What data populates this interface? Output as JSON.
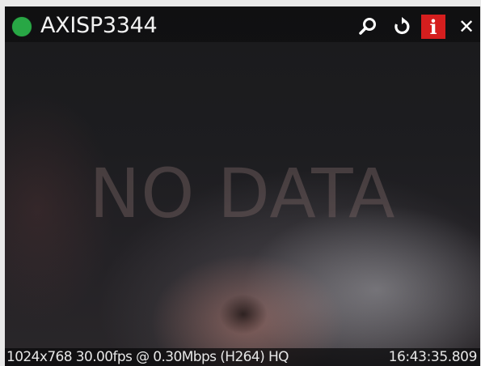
{
  "camera": {
    "name": "AXISP3344",
    "status": "online",
    "status_color": "#28a745"
  },
  "toolbar": {
    "icons": [
      "search-icon",
      "refresh-icon",
      "info-icon",
      "close-icon"
    ],
    "info_glyph": "i",
    "close_glyph": "✕",
    "info_color": "#d51e1e"
  },
  "video": {
    "message": "NO DATA"
  },
  "stream_info": {
    "details": "1024x768 30.00fps @ 0.30Mbps (H264) HQ",
    "timestamp": "16:43:35.809"
  }
}
